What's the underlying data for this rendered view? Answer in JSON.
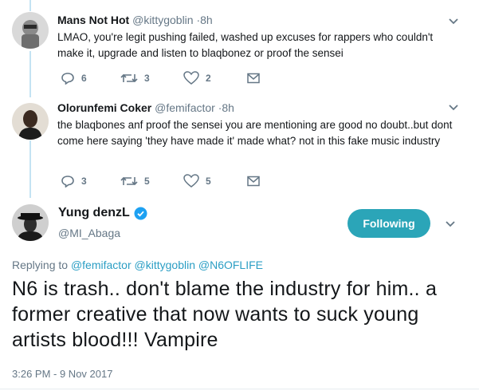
{
  "replies": [
    {
      "name": "Mans Not Hot",
      "handle": "@kittygoblin",
      "time": "·8h",
      "text": "LMAO, you're legit pushing failed, washed up excuses for rappers who couldn't make it, upgrade and listen to blaqbonez or proof the sensei",
      "reply_count": "6",
      "retweet_count": "3",
      "like_count": "2"
    },
    {
      "name": "Olorunfemi Coker",
      "handle": "@femifactor",
      "time": "·8h",
      "text": "the blaqbones anf proof the sensei you are mentioning are good no doubt..but dont come here saying 'they have made it' made what? not in this fake music industry",
      "reply_count": "3",
      "retweet_count": "5",
      "like_count": "5"
    }
  ],
  "main_tweet": {
    "name": "Yung denzL",
    "handle": "@MI_Abaga",
    "follow_label": "Following",
    "replying_prefix": "Replying to",
    "mentions": [
      "@femifactor",
      "@kittygoblin",
      "@N6OFLIFE"
    ],
    "text": "N6 is trash.. don't blame the industry for him.. a former creative that now wants to suck young artists blood!!! Vampire",
    "timestamp": "3:26 PM - 9 Nov 2017"
  },
  "colors": {
    "accent": "#2ba5b8",
    "link": "#2b9ec4",
    "muted": "#657786",
    "thread_line": "#c4e3f3"
  }
}
